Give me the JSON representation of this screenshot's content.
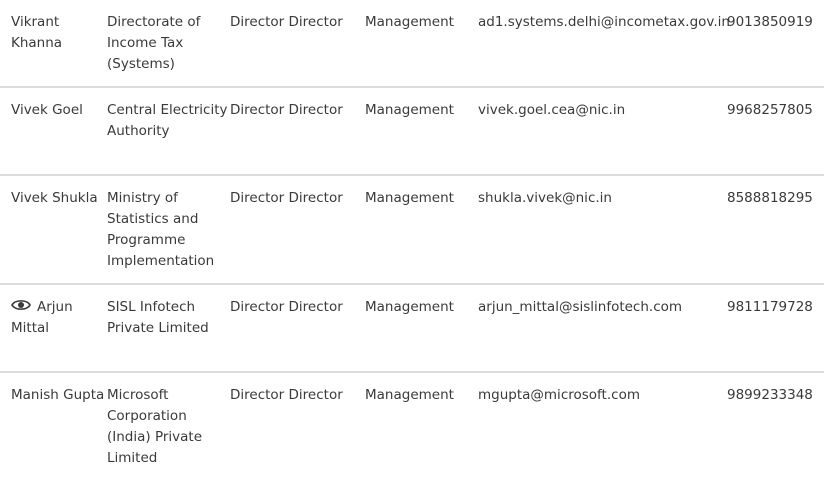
{
  "rows": [
    {
      "name": "Vikrant Khanna",
      "organization": "Directorate of Income Tax (Systems)",
      "designation": "Director Director",
      "department": "Management",
      "email": "ad1.systems.delhi@incometax.gov.in",
      "phone": "9013850919"
    },
    {
      "name": "Vivek Goel",
      "organization": "Central Electricity Authority",
      "designation": "Director Director",
      "department": "Management",
      "email": "vivek.goel.cea@nic.in",
      "phone": "9968257805"
    },
    {
      "name": "Vivek Shukla",
      "organization": "Ministry of Statistics and Programme Implementation",
      "designation": "Director Director",
      "department": "Management",
      "email": "shukla.vivek@nic.in",
      "phone": "8588818295"
    },
    {
      "name": "Arjun Mittal",
      "organization": "SISL Infotech Private Limited",
      "designation": "Director Director",
      "department": "Management",
      "email": "arjun_mittal@sislinfotech.com",
      "phone": "9811179728",
      "icon": "eye-icon"
    },
    {
      "name": "Manish Gupta",
      "organization": "Microsoft Corporation (India) Private Limited",
      "designation": "Director Director",
      "department": "Management",
      "email": "mgupta@microsoft.com",
      "phone": "9899233348"
    }
  ]
}
